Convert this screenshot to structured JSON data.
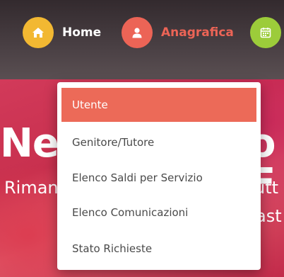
{
  "colors": {
    "home_icon_bg": "#f2b832",
    "anagrafica_icon_bg": "#ec6456",
    "anagrafica_text": "#ec6456",
    "calendar_icon_bg": "#9ccc3a",
    "active_item_bg": "#ec6a58",
    "hero_red": "#d23a5a"
  },
  "nav": {
    "home": {
      "label": "Home",
      "icon": "home-icon"
    },
    "anagrafica": {
      "label": "Anagrafica",
      "icon": "user-icon"
    },
    "calendar": {
      "icon": "calendar-icon"
    }
  },
  "dropdown": {
    "items": [
      {
        "label": "Utente",
        "active": true
      },
      {
        "label": "Genitore/Tutore",
        "active": false
      },
      {
        "label": "Elenco Saldi per Servizio",
        "active": false
      },
      {
        "label": "Elenco Comunicazioni",
        "active": false
      },
      {
        "label": "Stato Richieste",
        "active": false
      }
    ]
  },
  "hero": {
    "title_left": "Nev",
    "title_right": "o F",
    "subtitle_left": "Riman",
    "subtitle_right_1": "utt",
    "subtitle_right_2": "ast"
  }
}
